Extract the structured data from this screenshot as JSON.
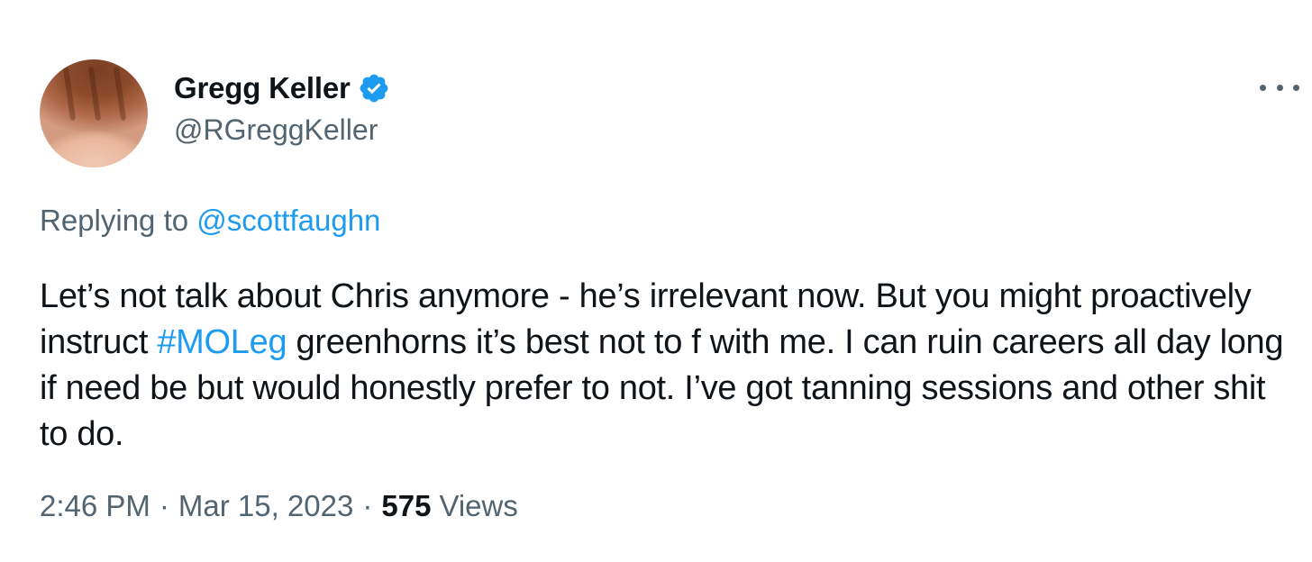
{
  "author": {
    "display_name": "Gregg Keller",
    "handle": "@RGreggKeller",
    "verified": true,
    "verified_color": "#1d9bf0",
    "avatar_icon": "profile-photo"
  },
  "menu": {
    "more_icon": "more-horizontal-icon"
  },
  "reply": {
    "prefix": "Replying to",
    "mention": "@scottfaughn"
  },
  "body": {
    "part1": "Let’s not talk about Chris anymore - he’s irrelevant now. But you might proactively instruct ",
    "hashtag": "#MOLeg",
    "part2": " greenhorns it’s best not to f with me. I can ruin careers all day long if need be but would honestly prefer to not. I’ve got tanning sessions and other shit to do."
  },
  "meta": {
    "time": "2:46 PM",
    "separator": "·",
    "date": "Mar 15, 2023",
    "views_count": "575",
    "views_label": "Views"
  },
  "colors": {
    "text_primary": "#0f1419",
    "text_secondary": "#536471",
    "link": "#1d9bf0",
    "background": "#ffffff"
  }
}
